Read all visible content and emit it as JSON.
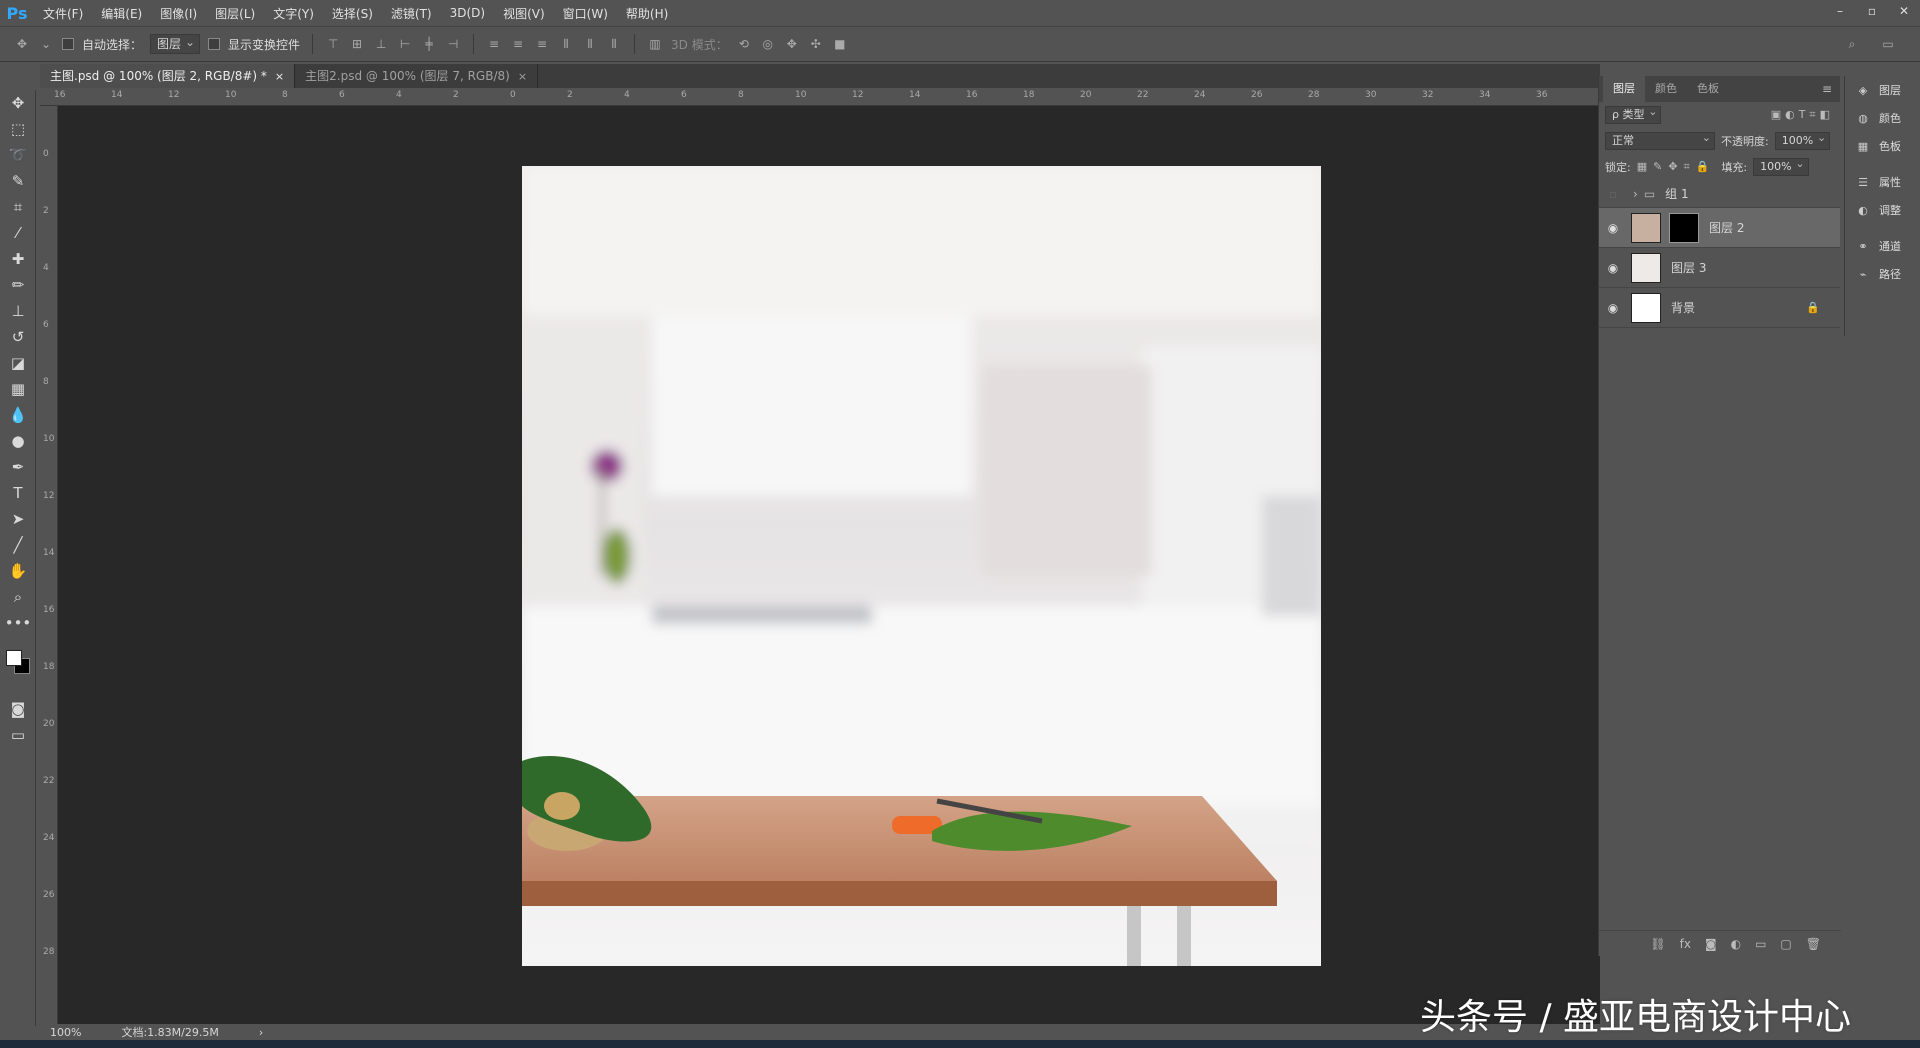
{
  "app": {
    "logo": "Ps"
  },
  "menu": [
    "文件(F)",
    "编辑(E)",
    "图像(I)",
    "图层(L)",
    "文字(Y)",
    "选择(S)",
    "滤镜(T)",
    "3D(D)",
    "视图(V)",
    "窗口(W)",
    "帮助(H)"
  ],
  "window_controls": {
    "minimize": "–",
    "restore": "▫",
    "close": "✕"
  },
  "options": {
    "auto_select_label": "自动选择：",
    "auto_select_value": "图层",
    "transform_label": "显示变换控件",
    "mode_3d_label": "3D 模式："
  },
  "tabs": [
    {
      "label": "主图.psd @ 100% (图层 2, RGB/8#) *",
      "close": "×"
    },
    {
      "label": "主图2.psd @ 100% (图层 7, RGB/8)",
      "close": "×"
    }
  ],
  "ruler_top_labels": [
    "16",
    "14",
    "12",
    "10",
    "8",
    "6",
    "4",
    "2",
    "0",
    "2",
    "4",
    "6",
    "8",
    "10",
    "12",
    "14",
    "16",
    "18",
    "20",
    "22",
    "24",
    "26",
    "28",
    "30",
    "32",
    "34",
    "36"
  ],
  "ruler_left_labels": [
    "2",
    "0",
    "2",
    "4",
    "6",
    "8",
    "10",
    "12",
    "14",
    "16",
    "18",
    "20",
    "22",
    "24",
    "26",
    "28"
  ],
  "status": {
    "zoom": "100%",
    "doc": "文档:1.83M/29.5M",
    "arrow": "›"
  },
  "layers_panel": {
    "tabs": [
      "图层",
      "颜色",
      "色板"
    ],
    "filter_label": "ρ 类型",
    "blend_mode": "正常",
    "opacity_label": "不透明度:",
    "opacity_value": "100%",
    "lock_label": "锁定:",
    "fill_label": "填充:",
    "fill_value": "100%",
    "layers": [
      {
        "name": "组 1",
        "visible": false,
        "type": "group"
      },
      {
        "name": "图层 2",
        "visible": true,
        "type": "masked",
        "selected": true
      },
      {
        "name": "图层 3",
        "visible": true,
        "type": "image"
      },
      {
        "name": "背景",
        "visible": true,
        "type": "background",
        "locked": true
      }
    ],
    "footer_icons": [
      "link-icon",
      "fx-icon",
      "mask-icon",
      "adjustment-icon",
      "folder-icon",
      "new-layer-icon",
      "trash-icon"
    ]
  },
  "dock": [
    {
      "label": "图层",
      "icon": "layers-icon"
    },
    {
      "label": "颜色",
      "icon": "color-icon"
    },
    {
      "label": "色板",
      "icon": "swatches-icon"
    },
    {
      "label": "属性",
      "icon": "properties-icon"
    },
    {
      "label": "调整",
      "icon": "adjustments-icon"
    },
    {
      "label": "通道",
      "icon": "channels-icon"
    },
    {
      "label": "路径",
      "icon": "paths-icon"
    }
  ],
  "watermark": "头条号 / 盛亚电商设计中心"
}
